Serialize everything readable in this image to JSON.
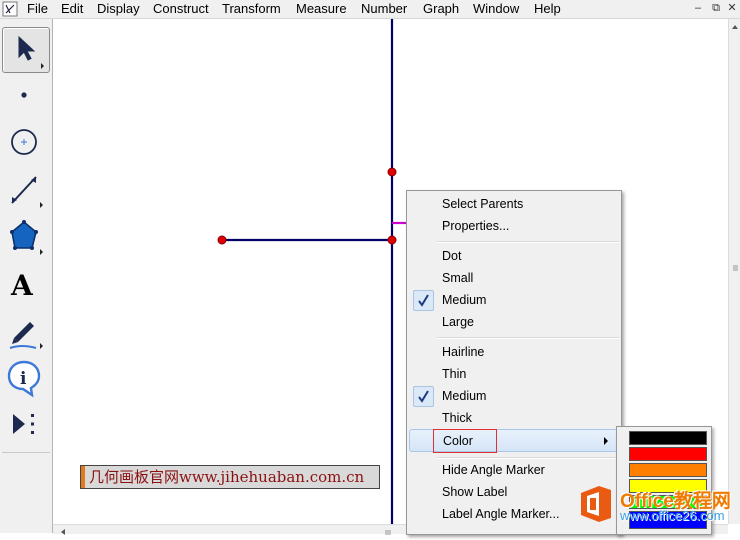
{
  "menubar": {
    "items": [
      "File",
      "Edit",
      "Display",
      "Construct",
      "Transform",
      "Measure",
      "Number",
      "Graph",
      "Window",
      "Help"
    ],
    "window_buttons": [
      "–",
      "⧉",
      "✕"
    ]
  },
  "toolbox": {
    "tools": [
      "arrow-select-tool",
      "point-tool",
      "compass-tool",
      "straightedge-tool",
      "polygon-tool",
      "text-tool",
      "marker-tool",
      "information-tool",
      "custom-tool"
    ],
    "selected": "arrow-select-tool",
    "text_tool_glyph": "A",
    "info_tool_glyph": "i"
  },
  "canvas": {
    "watermark_text": "几何画板官网www.jihehuaban.com.cn",
    "colors": {
      "line": "#000066",
      "point_fill": "#e00000",
      "point_stroke": "#800000",
      "angle_marker": "#cc00cc"
    }
  },
  "context_menu": {
    "group1": [
      "Select Parents",
      "Properties..."
    ],
    "group2": [
      {
        "label": "Dot",
        "checked": false
      },
      {
        "label": "Small",
        "checked": false
      },
      {
        "label": "Medium",
        "checked": true
      },
      {
        "label": "Large",
        "checked": false
      }
    ],
    "group3": [
      {
        "label": "Hairline",
        "checked": false
      },
      {
        "label": "Thin",
        "checked": false
      },
      {
        "label": "Medium",
        "checked": true
      },
      {
        "label": "Thick",
        "checked": false
      }
    ],
    "color_item": "Color",
    "group4": [
      "Hide Angle Marker",
      "Show Label",
      "Label Angle Marker..."
    ],
    "check_glyph": "✓"
  },
  "color_submenu": {
    "swatches": [
      "#000000",
      "#ff0000",
      "#ff8000",
      "#ffff00",
      "#00ff00",
      "#0000ff"
    ]
  },
  "brand": {
    "title": "Office教程网",
    "url": "www.office26.com"
  }
}
